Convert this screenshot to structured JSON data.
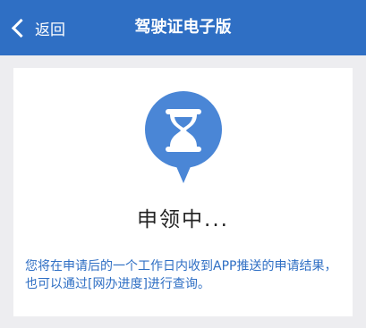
{
  "navbar": {
    "back_label": "返回",
    "title": "驾驶证电子版"
  },
  "status": {
    "icon": "hourglass-icon",
    "title": "申领中...",
    "description": "您将在申请后的一个工作日内收到APP推送的申请结果，也可以通过[网办进度]进行查询。"
  },
  "colors": {
    "primary": "#2f6fc4",
    "background": "#ededf0",
    "card": "#ffffff"
  }
}
